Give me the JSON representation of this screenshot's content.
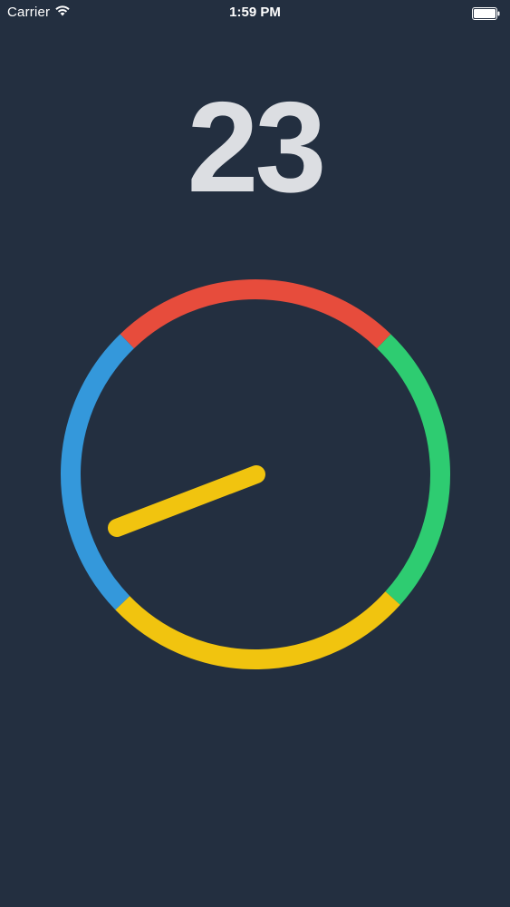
{
  "status_bar": {
    "carrier": "Carrier",
    "time": "1:59 PM",
    "wifi_icon": "wifi-icon",
    "battery_icon": "battery-icon"
  },
  "game": {
    "score": "23",
    "ring_segments": [
      {
        "color": "#e74c3c",
        "name": "red"
      },
      {
        "color": "#2ecc71",
        "name": "green"
      },
      {
        "color": "#f1c40f",
        "name": "yellow"
      },
      {
        "color": "#3498db",
        "name": "blue"
      }
    ],
    "needle_color": "#f1c40f",
    "background": "#232f40"
  }
}
